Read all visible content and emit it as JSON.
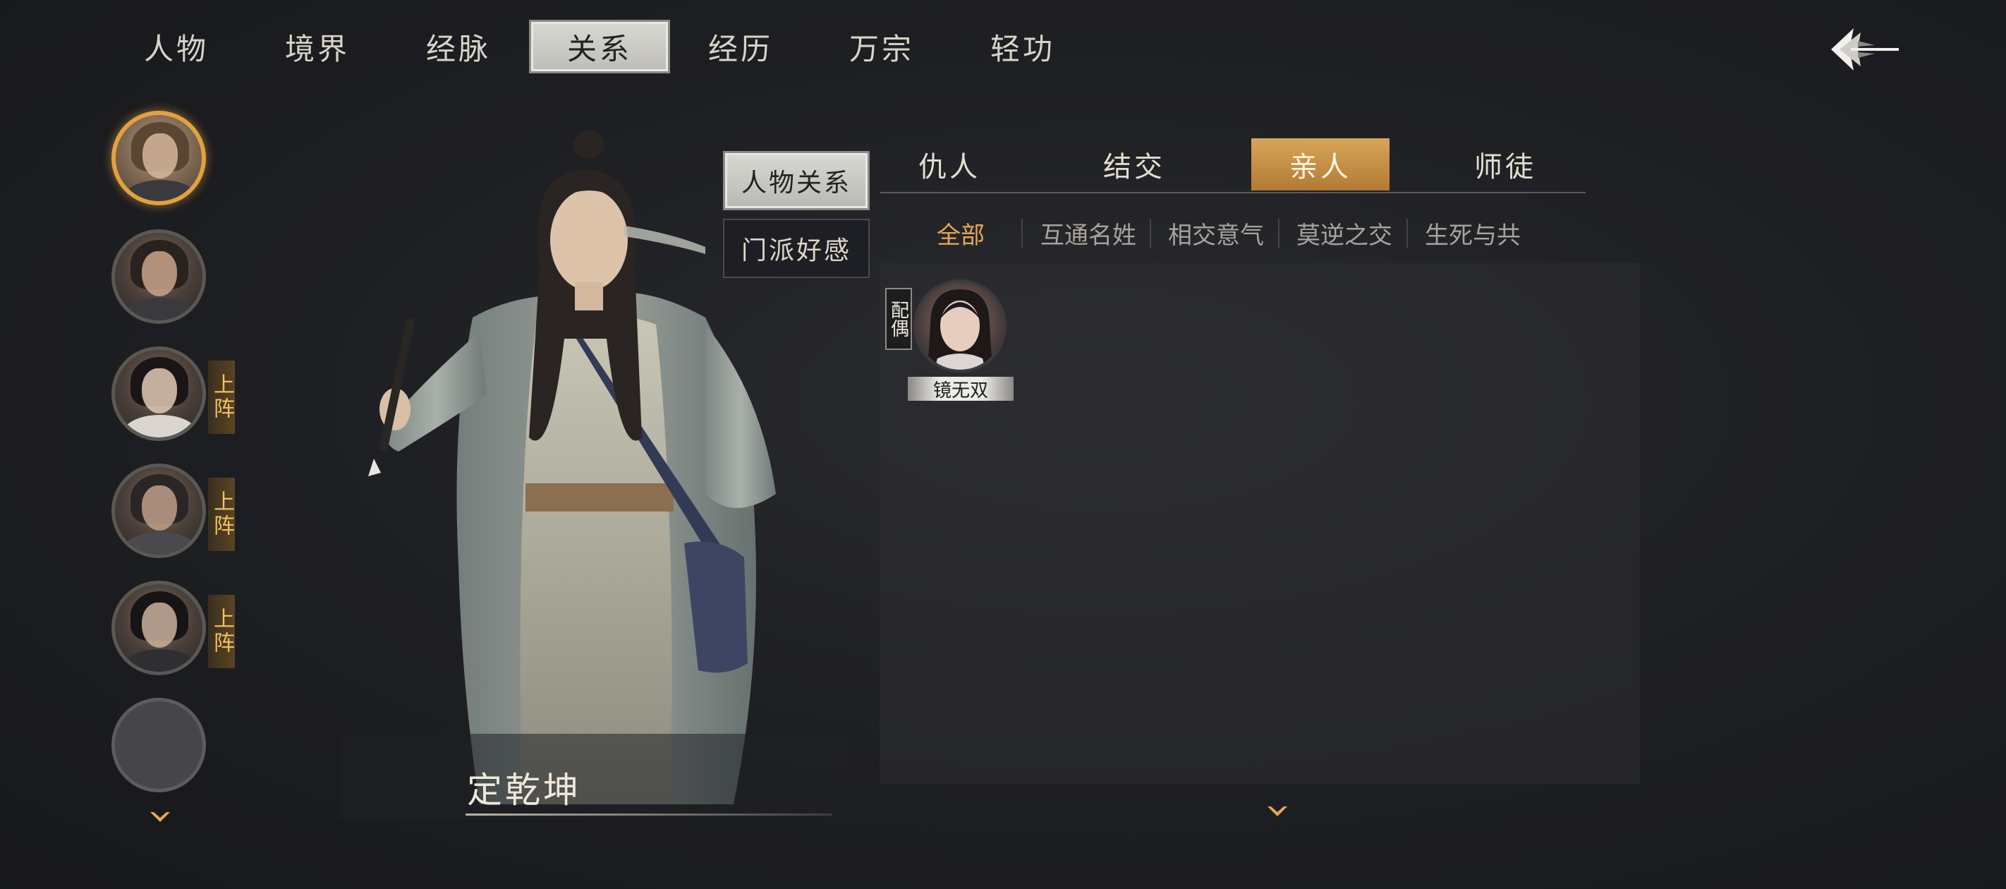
{
  "top_nav": {
    "tabs": [
      "人物",
      "境界",
      "经脉",
      "关系",
      "经历",
      "万宗",
      "轻功"
    ],
    "active_index": 3
  },
  "sidebar": {
    "avatars": [
      {
        "badge": "",
        "selected": true
      },
      {
        "badge": "",
        "selected": false
      },
      {
        "badge": "上阵",
        "selected": false
      },
      {
        "badge": "上阵",
        "selected": false
      },
      {
        "badge": "上阵",
        "selected": false
      },
      {
        "badge": "",
        "selected": false,
        "empty": true
      }
    ]
  },
  "character": {
    "name": "定乾坤"
  },
  "side_tabs": {
    "character_relations": "人物关系",
    "sect_favor": "门派好感"
  },
  "relation_tabs": {
    "tabs": [
      "仇人",
      "结交",
      "亲人",
      "师徒"
    ],
    "active_index": 2
  },
  "filters": {
    "items": [
      "全部",
      "互通名姓",
      "相交意气",
      "莫逆之交",
      "生死与共"
    ],
    "active_index": 0
  },
  "members": [
    {
      "tag": "配偶",
      "name": "镜无双"
    }
  ],
  "colors": {
    "accent": "#e4a955",
    "selected_border": "#e2a13f",
    "badge_text": "#f1c15d"
  },
  "icons": {
    "back": "back-arrow-icon",
    "scroll": "chevron-down-icon"
  }
}
